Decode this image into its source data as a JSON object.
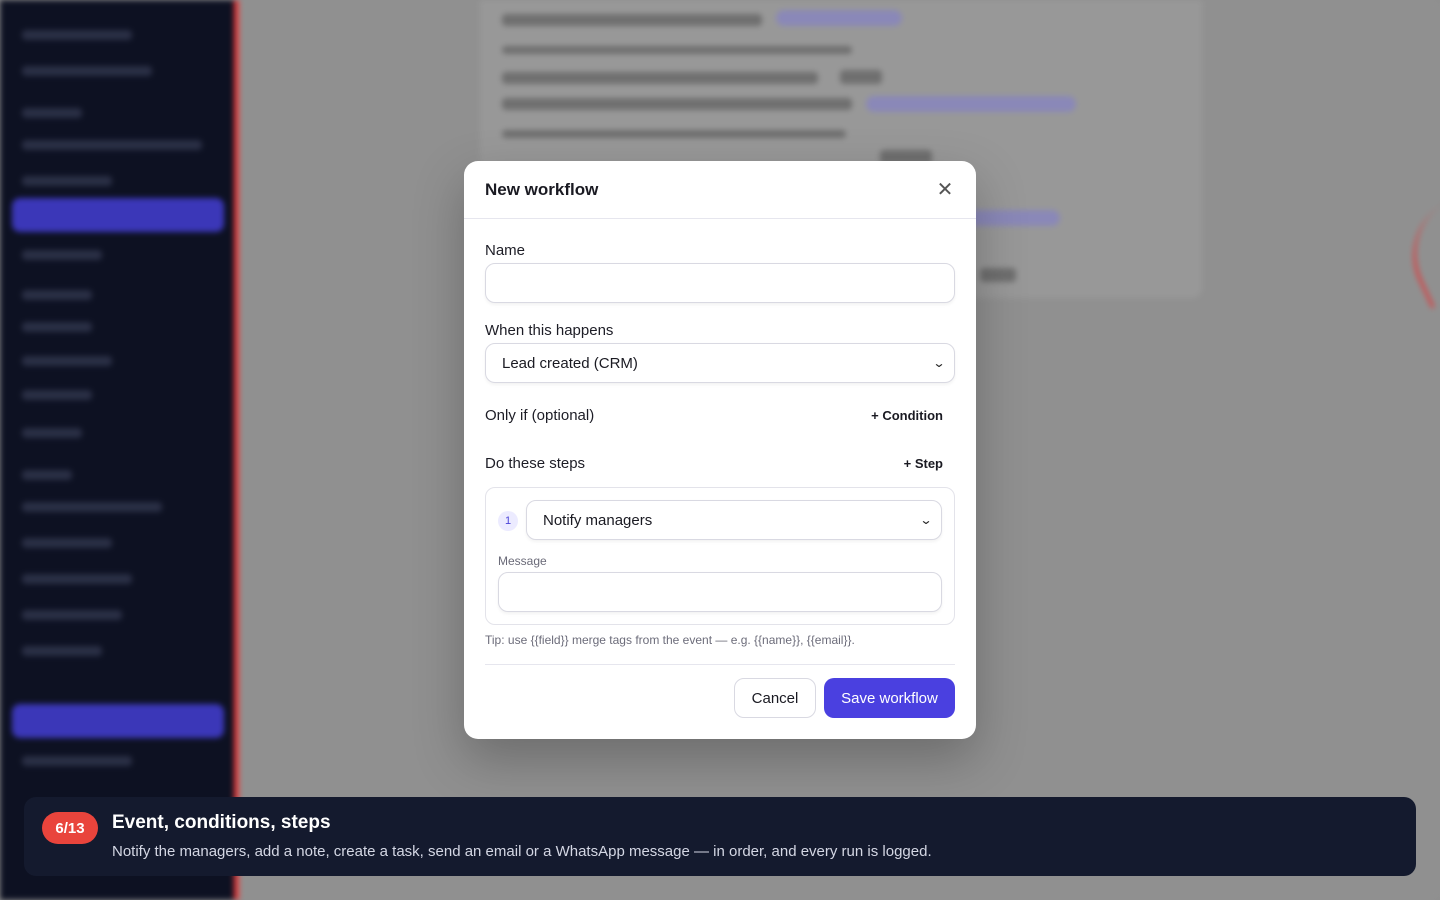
{
  "modal": {
    "title": "New workflow",
    "name_label": "Name",
    "name_value": "",
    "when_label": "When this happens",
    "when_value": "Lead created (CRM)",
    "only_if_label": "Only if (optional)",
    "add_condition": "+ Condition",
    "steps_label": "Do these steps",
    "add_step": "+ Step",
    "steps": [
      {
        "number": "1",
        "action": "Notify managers",
        "message_label": "Message",
        "message_value": ""
      }
    ],
    "tip": "Tip: use {{field}} merge tags from the event — e.g. {{name}}, {{email}}.",
    "cancel": "Cancel",
    "save": "Save workflow"
  },
  "tour": {
    "step": "6/13",
    "title": "Event, conditions, steps",
    "text": "Notify the managers, add a note, create a task, send an email or a WhatsApp message — in order, and every run is logged."
  },
  "icons": {
    "close": "close-icon",
    "chevron": "chevron-down-icon"
  },
  "colors": {
    "accent": "#4a40e0",
    "badge": "#e9443c",
    "banner": "#141a2e",
    "sidebar": "#0d1122"
  }
}
